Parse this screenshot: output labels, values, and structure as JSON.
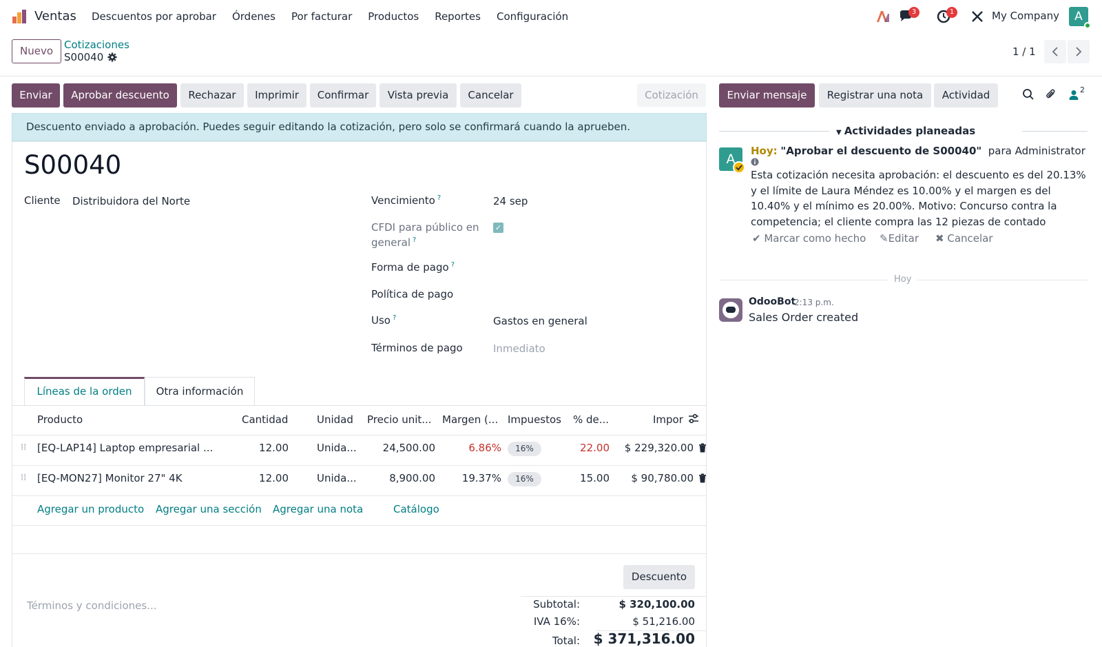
{
  "nav": {
    "app": "Ventas",
    "menu": [
      "Descuentos por aprobar",
      "Órdenes",
      "Por facturar",
      "Productos",
      "Reportes",
      "Configuración"
    ],
    "messages_badge": "3",
    "activities_badge": "1",
    "company": "My Company",
    "avatar_letter": "A"
  },
  "control": {
    "new_button": "Nuevo",
    "breadcrumb_parent": "Cotizaciones",
    "breadcrumb_current": "S00040",
    "pager": "1 / 1"
  },
  "actions": {
    "send": "Enviar",
    "approve_discount": "Aprobar descuento",
    "reject": "Rechazar",
    "print": "Imprimir",
    "confirm": "Confirmar",
    "preview": "Vista previa",
    "cancel": "Cancelar",
    "status": "Cotización"
  },
  "alert": "Descuento enviado a aprobación. Puedes seguir editando la cotización, pero solo se confirmará cuando la aprueben.",
  "form": {
    "title": "S00040",
    "customer_label": "Cliente",
    "customer_value": "Distribuidora del Norte",
    "due_label": "Vencimiento",
    "due_value": "24 sep",
    "cfdi_label_1": "CFDI para público en",
    "cfdi_label_2": "general",
    "cfdi_checked": true,
    "payment_form_label": "Forma de pago",
    "payment_policy_label": "Política de pago",
    "usage_label": "Uso",
    "usage_value": "Gastos en general",
    "terms_label": "Términos de pago",
    "terms_value": "Inmediato",
    "qmark": "?"
  },
  "tabs": [
    "Líneas de la orden",
    "Otra información"
  ],
  "table": {
    "headers": [
      "Producto",
      "Cantidad",
      "Unidad",
      "Precio unit...",
      "Margen (...",
      "Impuestos",
      "% de...",
      "Impor"
    ],
    "rows": [
      {
        "product": "[EQ-LAP14] Laptop empresarial ...",
        "qty": "12.00",
        "unit": "Unida...",
        "price": "24,500.00",
        "margin": "6.86%",
        "tax": "16%",
        "discount": "22.00",
        "amount": "$ 229,320.00",
        "margin_color": "#c4312b",
        "discount_color": "#c4312b"
      },
      {
        "product": "[EQ-MON27] Monitor 27\" 4K",
        "qty": "12.00",
        "unit": "Unida...",
        "price": "8,900.00",
        "margin": "19.37%",
        "tax": "16%",
        "discount": "15.00",
        "amount": "$ 90,780.00",
        "margin_color": "#1f2937",
        "discount_color": "#1f2937"
      }
    ],
    "add_links": [
      "Agregar un producto",
      "Agregar una sección",
      "Agregar una nota",
      "Catálogo"
    ]
  },
  "bottom": {
    "terms_placeholder": "Términos y condiciones...",
    "discount_button": "Descuento",
    "subtotal_label": "Subtotal:",
    "subtotal_value": "$ 320,100.00",
    "iva_label": "IVA 16%:",
    "iva_value": "$ 51,216.00",
    "total_label": "Total:",
    "total_value": "$ 371,316.00"
  },
  "chatter": {
    "send_message": "Enviar mensaje",
    "log_note": "Registrar una nota",
    "activity": "Actividad",
    "followers_count": "2",
    "planned_header": "Actividades planeadas",
    "activity_avatar": "A",
    "activity_today": "Hoy:",
    "activity_title": "\"Aprobar el descuento de S00040\"",
    "activity_for": "para",
    "activity_user": "Administrator",
    "activity_body": "Esta cotización necesita aprobación: el descuento es del 20.13% y el límite de Laura Méndez es 10.00% y el margen es del 10.40% y el mínimo es 20.00%. Motivo: Concurso contra la competencia; el cliente compra las 12 piezas de contado",
    "mark_done": "Marcar como hecho",
    "edit": "Editar",
    "cancel": "Cancelar",
    "day_separator": "Hoy",
    "bot_name": "OdooBot",
    "bot_time": "2:13 p.m.",
    "bot_message": "Sales Order created"
  },
  "colors": {
    "primary": "#714b67",
    "link": "#017e84",
    "alert_bg": "#d2ebf0",
    "negative": "#c4312b"
  }
}
